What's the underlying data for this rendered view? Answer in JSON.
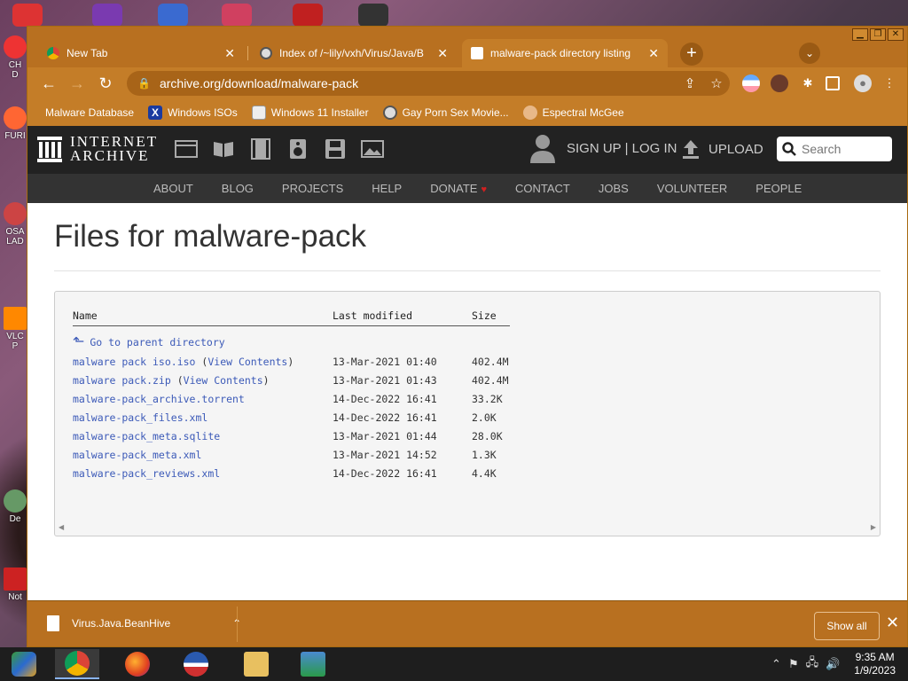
{
  "desktop": {
    "icons": [
      {
        "label": "CH\nD",
        "color": "#e33"
      },
      {
        "label": "FURI",
        "color": "#f63"
      },
      {
        "label": "OSA\nLAD",
        "color": "#c44"
      },
      {
        "label": "VLC\nP",
        "color": "#f80"
      },
      {
        "label": "De",
        "color": "#696"
      },
      {
        "label": "Not",
        "color": "#c22"
      }
    ]
  },
  "window": {
    "controls": {
      "minimize": "▁",
      "restore": "❐",
      "close": "✕"
    },
    "tabs": [
      {
        "title": "New Tab",
        "favicon": "chrome-icon"
      },
      {
        "title": "Index of /~lily/vxh/Virus/Java/B",
        "favicon": "globe-icon"
      },
      {
        "title": "malware-pack directory listing",
        "favicon": "archive-icon"
      }
    ],
    "new_tab": "+",
    "tab_search": "⌄",
    "toolbar": {
      "back": "←",
      "forward": "→",
      "reload": "↻",
      "url": "archive.org/download/malware-pack",
      "share": "⇪",
      "bookmark_star": "☆"
    },
    "bookmarks": [
      {
        "label": "Malware Database",
        "icon": "blank-bookmark-icon"
      },
      {
        "label": "Windows ISOs",
        "icon": "x-logo-icon"
      },
      {
        "label": "Windows 11 Installer",
        "icon": "image-icon"
      },
      {
        "label": "Gay Porn Sex Movie...",
        "icon": "globe-icon"
      },
      {
        "label": "Espectral McGee",
        "icon": "face-icon"
      }
    ]
  },
  "ia": {
    "logo_line1": "INTERNET",
    "logo_line2": "ARCHIVE",
    "signup": "SIGN UP | LOG IN",
    "upload": "UPLOAD",
    "search_placeholder": "Search",
    "nav": [
      "ABOUT",
      "BLOG",
      "PROJECTS",
      "HELP",
      "DONATE",
      "CONTACT",
      "JOBS",
      "VOLUNTEER",
      "PEOPLE"
    ],
    "heart": "♥"
  },
  "listing": {
    "title": "Files for malware-pack",
    "headers": {
      "name": "Name",
      "modified": "Last modified",
      "size": "Size"
    },
    "parent": "Go to parent directory",
    "rows": [
      {
        "name": "malware pack iso.iso",
        "extra": "View Contents",
        "modified": "13-Mar-2021 01:40",
        "size": "402.4M"
      },
      {
        "name": "malware pack.zip",
        "extra": "View Contents",
        "modified": "13-Mar-2021 01:43",
        "size": "402.4M"
      },
      {
        "name": "malware-pack_archive.torrent",
        "extra": "",
        "modified": "14-Dec-2022 16:41",
        "size": "33.2K"
      },
      {
        "name": "malware-pack_files.xml",
        "extra": "",
        "modified": "14-Dec-2022 16:41",
        "size": "2.0K"
      },
      {
        "name": "malware-pack_meta.sqlite",
        "extra": "",
        "modified": "13-Mar-2021 01:44",
        "size": "28.0K"
      },
      {
        "name": "malware-pack_meta.xml",
        "extra": "",
        "modified": "13-Mar-2021 14:52",
        "size": "1.3K"
      },
      {
        "name": "malware-pack_reviews.xml",
        "extra": "",
        "modified": "14-Dec-2022 16:41",
        "size": "4.4K"
      }
    ]
  },
  "downloads": {
    "filename": "Virus.Java.BeanHive",
    "show_all": "Show all",
    "close": "✕"
  },
  "taskbar": {
    "time": "9:35 AM",
    "date": "1/9/2023"
  },
  "colors": {
    "chrome_theme": "#c47d28",
    "link": "#3c5ab8",
    "ia_header": "#222222"
  }
}
